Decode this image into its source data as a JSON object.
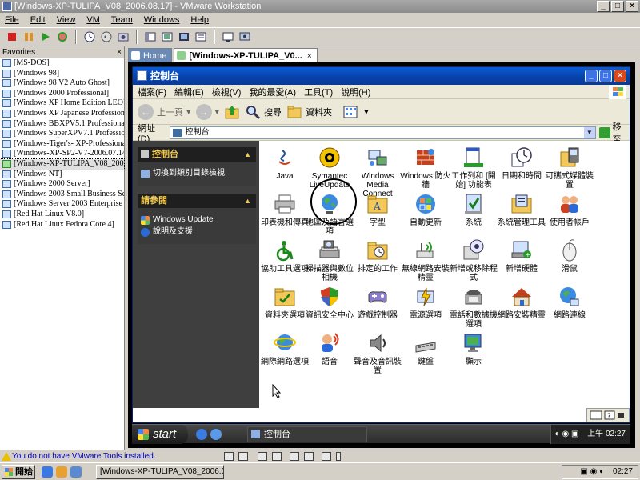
{
  "window": {
    "title": "[Windows-XP-TULIPA_V08_2006.08.17] - VMware Workstation"
  },
  "menu": [
    "File",
    "Edit",
    "View",
    "VM",
    "Team",
    "Windows",
    "Help"
  ],
  "favorites": {
    "title": "Favorites",
    "close": "×",
    "items": [
      "[MS-DOS]",
      "[Windows 98]",
      "[Windows 98 V2 Auto Ghost]",
      "[Windows 2000 Professional]",
      "[Windows XP Home Edition LEO]",
      "[Windows XP Japanese Professional",
      "[Windows BBXPV5.1 Professional]",
      "[Windows SuperXPV7.1 Professiona",
      "[Windows-Tiger's- XP-Professional-",
      "[Windows-XP-SP2-V7-2006.07.14_",
      "[Windows-XP-TULIPA_V08_2006.",
      "[Windows NT]",
      "[Windows 2000 Server]",
      "[Windows 2003 Small Business Serv",
      "[Windows Server 2003 Enterprise E",
      "[Red Hat Linux V8.0]",
      "[Red Hat Linux Fedora Core 4]"
    ],
    "selected_index": 10
  },
  "tabs": {
    "home": "Home",
    "active": "[Windows-XP-TULIPA_V0...",
    "close": "×"
  },
  "guest": {
    "title": "控制台",
    "menu": [
      "檔案(F)",
      "編輯(E)",
      "檢視(V)",
      "我的最愛(A)",
      "工具(T)",
      "說明(H)"
    ],
    "toolbar": {
      "back": "上一頁",
      "search": "搜尋",
      "folders": "資料夾"
    },
    "address": {
      "label": "網址(D)",
      "value": "控制台",
      "go": "移至"
    },
    "taskpane": {
      "section1_title": "控制台",
      "section1_link": "切換到類別目錄檢視",
      "section2_title": "請參閱",
      "section2_links": [
        "Windows Update",
        "說明及支援"
      ]
    },
    "icons": [
      "Java",
      "Symantec LiveUpdate",
      "Windows Media Connect",
      "Windows 防火牆",
      "工作列和 [開始] 功能表",
      "日期和時間",
      "可攜式媒體裝置",
      "印表機和傳真",
      "地區及語言選項",
      "字型",
      "自動更新",
      "系統",
      "系統管理工具",
      "使用者帳戶",
      "協助工具選項",
      "掃描器與數位相機",
      "排定的工作",
      "無線網路安裝精靈",
      "新增或移除程式",
      "新增硬體",
      "滑鼠",
      "資料夾選項",
      "資訊安全中心",
      "遊戲控制器",
      "電源選項",
      "電話和數據機選項",
      "網路安裝精靈",
      "網路連線",
      "網際網路選項",
      "語音",
      "聲音及音訊裝置",
      "鍵盤",
      "顯示"
    ],
    "taskbar": {
      "start": "start",
      "task_button": "控制台",
      "clock": "上午 02:27"
    }
  },
  "statusbar": {
    "message": "You do not have VMware Tools installed."
  },
  "host_taskbar": {
    "start": "開始",
    "clock": "02:27"
  },
  "colors": {
    "xp_title": "#0a5bd8",
    "taskpane": "#3f3f3f",
    "tp_heading": "#f2c94c",
    "status_text": "#0000c0"
  }
}
